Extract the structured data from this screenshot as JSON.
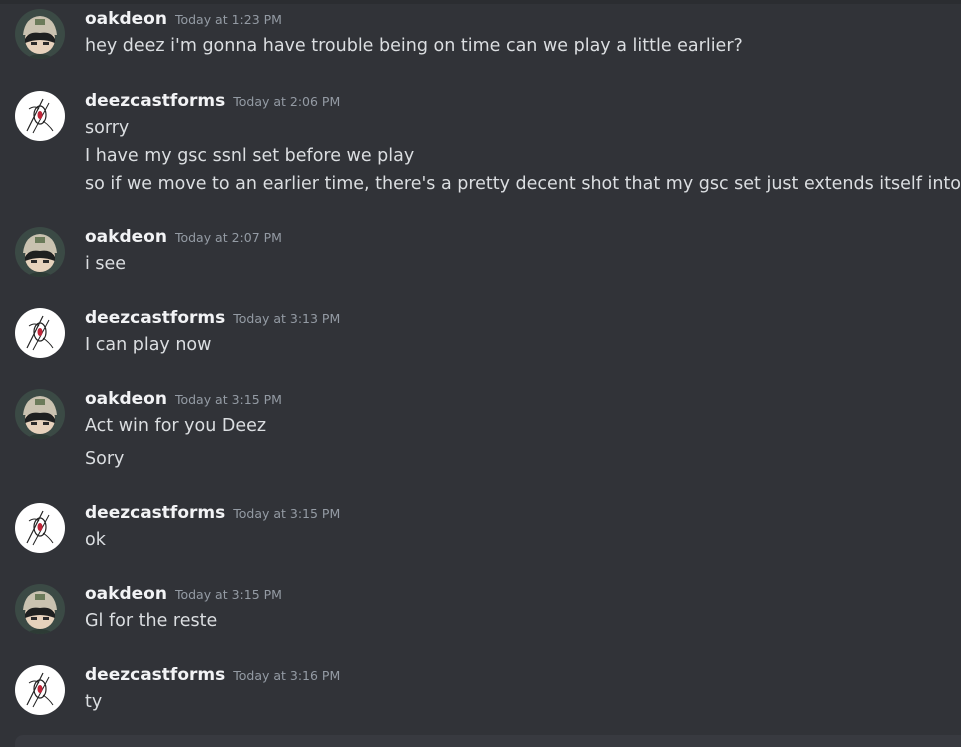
{
  "messages": [
    {
      "author": "oakdeon",
      "avatar": "oakdeon-avatar",
      "timestamp": "Today at 1:23 PM",
      "lines": [
        "hey deez i'm gonna have trouble being on time can we play a little earlier?"
      ]
    },
    {
      "author": "deezcastforms",
      "avatar": "deezcastforms-avatar",
      "timestamp": "Today at 2:06 PM",
      "lines": [
        "sorry",
        "I have my gsc ssnl set before we play",
        "so if we move to an earlier time, there's a pretty decent shot that my gsc set just extends itself into it"
      ]
    },
    {
      "author": "oakdeon",
      "avatar": "oakdeon-avatar",
      "timestamp": "Today at 2:07 PM",
      "lines": [
        "i see"
      ]
    },
    {
      "author": "deezcastforms",
      "avatar": "deezcastforms-avatar",
      "timestamp": "Today at 3:13 PM",
      "lines": [
        "I can play now"
      ]
    },
    {
      "author": "oakdeon",
      "avatar": "oakdeon-avatar",
      "timestamp": "Today at 3:15 PM",
      "lines": [
        "Act win for you Deez",
        "Sory"
      ]
    },
    {
      "author": "deezcastforms",
      "avatar": "deezcastforms-avatar",
      "timestamp": "Today at 3:15 PM",
      "lines": [
        "ok"
      ]
    },
    {
      "author": "oakdeon",
      "avatar": "oakdeon-avatar",
      "timestamp": "Today at 3:15 PM",
      "lines": [
        "Gl for the reste"
      ]
    },
    {
      "author": "deezcastforms",
      "avatar": "deezcastforms-avatar",
      "timestamp": "Today at 3:16 PM",
      "lines": [
        "ty"
      ]
    }
  ],
  "colors": {
    "background": "#313338",
    "username": "#f2f3f5",
    "timestamp": "#949ba4",
    "text": "#dbdee1"
  }
}
